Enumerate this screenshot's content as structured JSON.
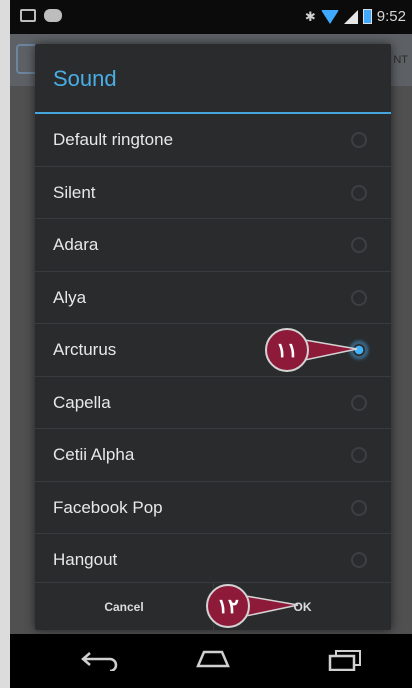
{
  "status_bar": {
    "time": "9:52"
  },
  "app_bar": {
    "tab_text": "NT"
  },
  "dialog": {
    "title": "Sound",
    "items": [
      {
        "label": "Default ringtone",
        "selected": false
      },
      {
        "label": "Silent",
        "selected": false
      },
      {
        "label": "Adara",
        "selected": false
      },
      {
        "label": "Alya",
        "selected": false
      },
      {
        "label": "Arcturus",
        "selected": true
      },
      {
        "label": "Capella",
        "selected": false
      },
      {
        "label": "Cetii Alpha",
        "selected": false
      },
      {
        "label": "Facebook Pop",
        "selected": false
      },
      {
        "label": "Hangout",
        "selected": false
      }
    ],
    "cancel_label": "Cancel",
    "ok_label": "OK"
  },
  "callouts": {
    "radio_step": "۱۱",
    "ok_step": "۱۲"
  },
  "colors": {
    "accent": "#46a6dc",
    "callout": "#8e1a3a",
    "dialog_bg": "#2a2b2d"
  },
  "icons": {
    "nav": [
      "back-icon",
      "home-icon",
      "recent-apps-icon"
    ],
    "status": [
      "notification-icon",
      "voicemail-icon",
      "bluetooth-icon",
      "wifi-icon",
      "signal-icon",
      "battery-icon"
    ]
  }
}
